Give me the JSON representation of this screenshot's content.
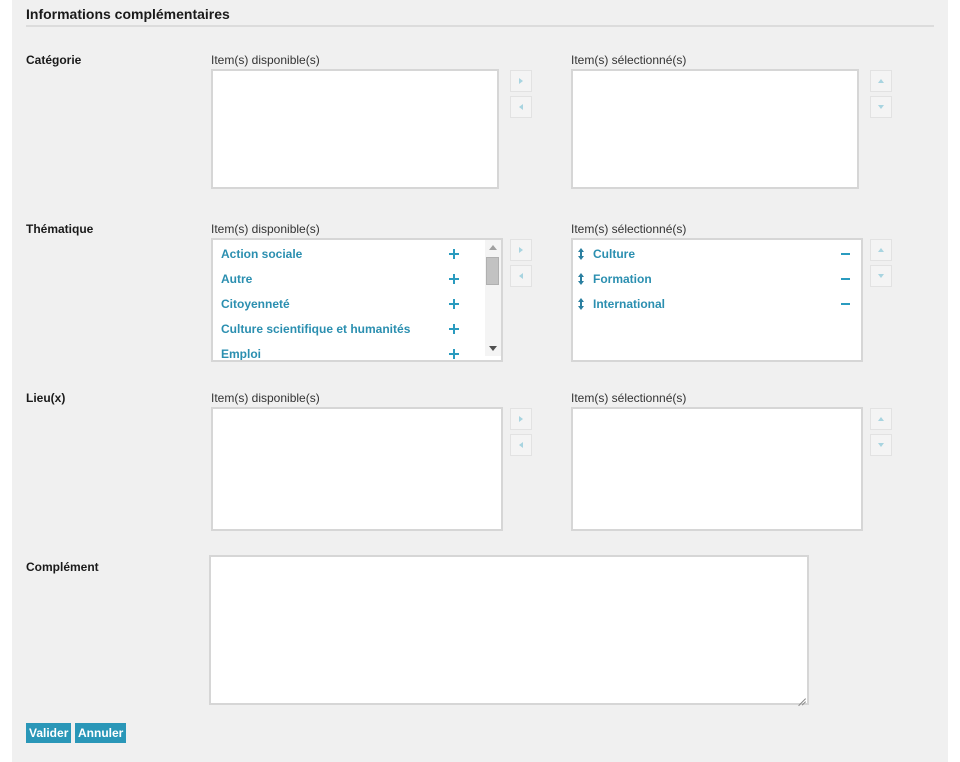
{
  "section_title": "Informations complémentaires",
  "rows": {
    "categorie": {
      "label": "Catégorie",
      "available_label": "Item(s) disponible(s)",
      "selected_label": "Item(s) sélectionné(s)"
    },
    "thematique": {
      "label": "Thématique",
      "available_label": "Item(s) disponible(s)",
      "selected_label": "Item(s) sélectionné(s)",
      "available_items": [
        "Action sociale",
        "Autre",
        "Citoyenneté",
        "Culture scientifique et humanités",
        "Emploi"
      ],
      "selected_items": [
        "Culture",
        "Formation",
        "International"
      ]
    },
    "lieux": {
      "label": "Lieu(x)",
      "available_label": "Item(s) disponible(s)",
      "selected_label": "Item(s) sélectionné(s)"
    },
    "complement": {
      "label": "Complément",
      "value": ""
    }
  },
  "buttons": {
    "valider": "Valider",
    "annuler": "Annuler"
  },
  "icons": {
    "add": "plus-icon",
    "remove": "minus-icon",
    "move": "sort-icon",
    "to_selected": "arrow-right-icon",
    "to_available": "arrow-left-icon",
    "move_up": "arrow-up-icon",
    "move_down": "arrow-down-icon"
  },
  "colors": {
    "accent": "#2a97b8",
    "item_text": "#2b8fb0",
    "panel_bg": "#f0f0f0"
  }
}
